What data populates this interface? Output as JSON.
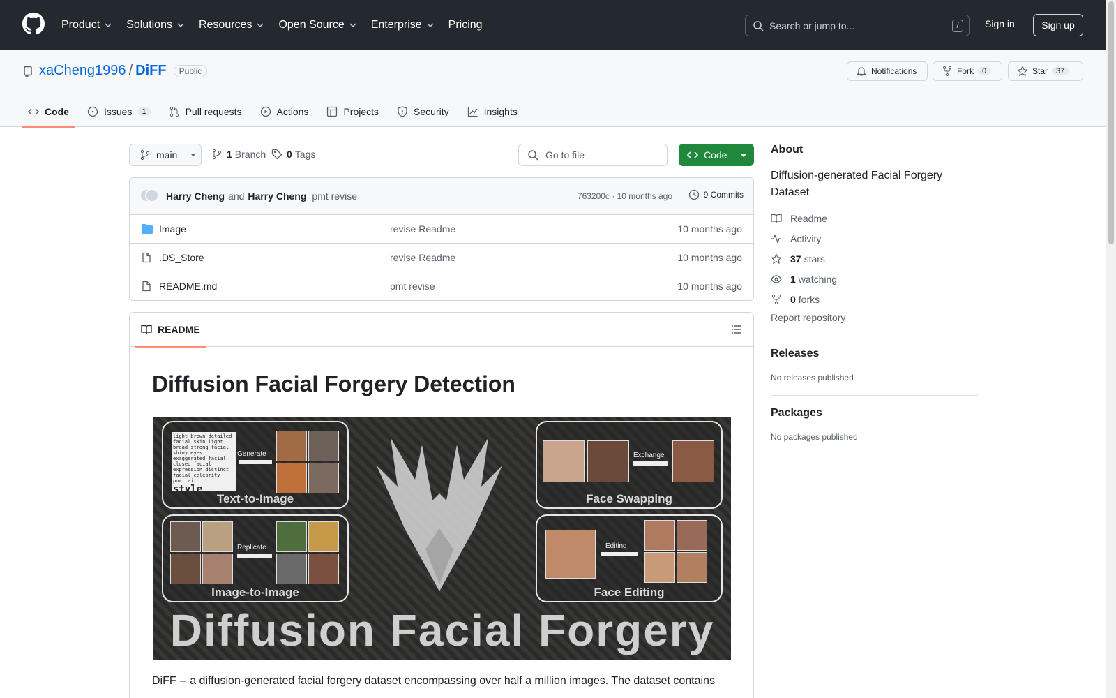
{
  "header": {
    "nav": [
      "Product",
      "Solutions",
      "Resources",
      "Open Source",
      "Enterprise",
      "Pricing"
    ],
    "search_placeholder": "Search or jump to...",
    "search_shortcut": "/",
    "signin": "Sign in",
    "signup": "Sign up"
  },
  "repo": {
    "owner": "xaCheng1996",
    "separator": "/",
    "name": "DiFF",
    "visibility": "Public",
    "notifications_label": "Notifications",
    "fork_label": "Fork",
    "fork_count": "0",
    "star_label": "Star",
    "star_count": "37"
  },
  "tabs": [
    {
      "label": "Code",
      "icon": "code-icon"
    },
    {
      "label": "Issues",
      "icon": "issue-icon",
      "count": "1"
    },
    {
      "label": "Pull requests",
      "icon": "pull-request-icon"
    },
    {
      "label": "Actions",
      "icon": "play-icon"
    },
    {
      "label": "Projects",
      "icon": "table-icon"
    },
    {
      "label": "Security",
      "icon": "shield-icon"
    },
    {
      "label": "Insights",
      "icon": "graph-icon"
    }
  ],
  "toolbar": {
    "branch": "main",
    "branch_count": "1",
    "branch_label": "Branch",
    "tag_count": "0",
    "tag_label": "Tags",
    "goto_placeholder": "Go to file",
    "code_button": "Code"
  },
  "commit": {
    "author1": "Harry Cheng",
    "and": "and",
    "author2": "Harry Cheng",
    "message": "pmt revise",
    "hash_time": "763200c · 10 months ago",
    "commits": "9 Commits"
  },
  "files": [
    {
      "name": "Image",
      "type": "folder",
      "message": "revise Readme",
      "date": "10 months ago"
    },
    {
      "name": ".DS_Store",
      "type": "file",
      "message": "revise Readme",
      "date": "10 months ago"
    },
    {
      "name": "README.md",
      "type": "file",
      "message": "pmt revise",
      "date": "10 months ago"
    }
  ],
  "readme": {
    "tab": "README",
    "title": "Diffusion Facial Forgery Detection",
    "banner": {
      "panel1": "Text-to-Image",
      "panel1_arrow": "Generate",
      "panel2": "Face Swapping",
      "panel2_arrow": "Exchange",
      "panel3": "Image-to-Image",
      "panel3_arrow": "Replicate",
      "panel4": "Face Editing",
      "panel4_arrow": "Editing",
      "big_title": "Diffusion Facial Forgery",
      "cloud_word": "style",
      "cloud_text": "light brown detailed facial skin light bread strong facial shiny eyes exaggerated facial closed facial expression distinct facial celebrity portrait"
    },
    "paragraph": "DiFF -- a diffusion-generated facial forgery dataset encompassing over half a million images. The dataset contains"
  },
  "sidebar": {
    "about_title": "About",
    "description": "Diffusion-generated Facial Forgery Dataset",
    "readme": "Readme",
    "activity": "Activity",
    "stars_count": "37",
    "stars": "stars",
    "watching_count": "1",
    "watching": "watching",
    "forks_count": "0",
    "forks": "forks",
    "report": "Report repository",
    "releases_title": "Releases",
    "releases_empty": "No releases published",
    "packages_title": "Packages",
    "packages_empty": "No packages published"
  },
  "colors": {
    "header_bg": "#24292f",
    "link": "#0969da",
    "primary_button": "#1f883d",
    "active_tab_underline": "#fd8c73"
  }
}
